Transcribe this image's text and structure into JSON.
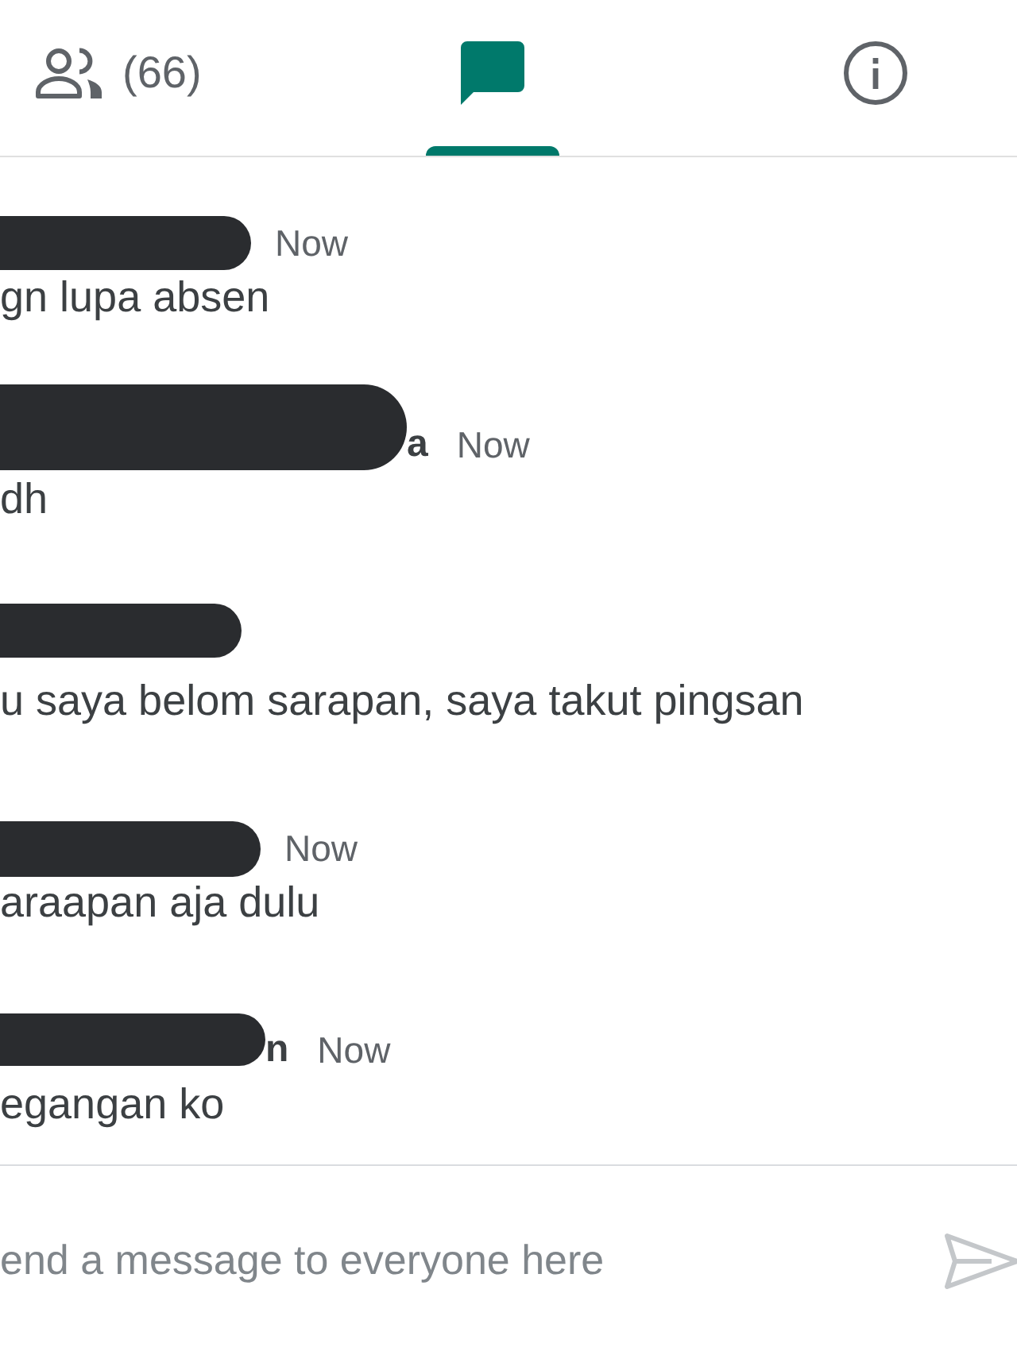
{
  "tabs": [
    {
      "kind": "people",
      "label": "(66)",
      "selected": false
    },
    {
      "kind": "chat",
      "selected": true
    },
    {
      "kind": "info",
      "selected": false
    }
  ],
  "messages": [
    {
      "redacted": true,
      "time": "Now",
      "text": "gn lupa absen"
    },
    {
      "redacted": true,
      "sender": "a",
      "time": "Now",
      "text": "dh"
    },
    {
      "redacted": true,
      "text": "u saya belom sarapan, saya takut pingsan"
    },
    {
      "redacted": true,
      "time": "Now",
      "text": "araapan aja dulu"
    },
    {
      "redacted": true,
      "sender": "n",
      "time": "Now",
      "text": "egangan ko"
    }
  ],
  "composer": {
    "placeholder": "end a message to everyone here",
    "send_disabled": true
  }
}
